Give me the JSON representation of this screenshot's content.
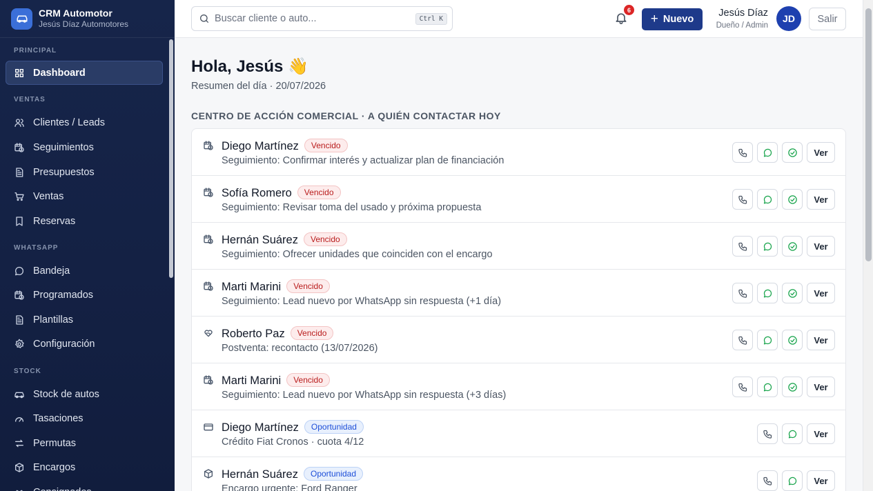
{
  "brand": {
    "title": "CRM Automotor",
    "subtitle": "Jesús Díaz Automotores"
  },
  "sidebar": {
    "sections": [
      {
        "label": "PRINCIPAL",
        "items": [
          {
            "label": "Dashboard",
            "icon": "grid-icon",
            "active": true
          }
        ]
      },
      {
        "label": "VENTAS",
        "items": [
          {
            "label": "Clientes / Leads",
            "icon": "users-icon"
          },
          {
            "label": "Seguimientos",
            "icon": "calendar-clock-icon"
          },
          {
            "label": "Presupuestos",
            "icon": "document-icon"
          },
          {
            "label": "Ventas",
            "icon": "cart-icon"
          },
          {
            "label": "Reservas",
            "icon": "bookmark-icon"
          }
        ]
      },
      {
        "label": "WHATSAPP",
        "items": [
          {
            "label": "Bandeja",
            "icon": "chat-icon"
          },
          {
            "label": "Programados",
            "icon": "calendar-clock-icon"
          },
          {
            "label": "Plantillas",
            "icon": "document-icon"
          },
          {
            "label": "Configuración",
            "icon": "gear-icon"
          }
        ]
      },
      {
        "label": "STOCK",
        "items": [
          {
            "label": "Stock de autos",
            "icon": "car-icon"
          },
          {
            "label": "Tasaciones",
            "icon": "gauge-icon"
          },
          {
            "label": "Permutas",
            "icon": "swap-icon"
          },
          {
            "label": "Encargos",
            "icon": "package-icon"
          },
          {
            "label": "Consignados",
            "icon": "handshake-icon"
          }
        ]
      }
    ]
  },
  "topbar": {
    "search_placeholder": "Buscar cliente o auto...",
    "shortcut": "Ctrl K",
    "notifications_count": "6",
    "new_label": "Nuevo",
    "user_name": "Jesús Díaz",
    "user_role": "Dueño / Admin",
    "avatar_initials": "JD",
    "exit_label": "Salir"
  },
  "main": {
    "greeting": "Hola, Jesús",
    "greeting_emoji": "👋",
    "subtitle": "Resumen del día · 20/07/2026",
    "section_title": "CENTRO DE ACCIÓN COMERCIAL · A QUIÉN CONTACTAR HOY",
    "view_label": "Ver",
    "rows": [
      {
        "name": "Diego Martínez",
        "badge": "Vencido",
        "badge_type": "red",
        "desc": "Seguimiento: Confirmar interés y actualizar plan de financiación",
        "icon": "calendar-clock-icon",
        "done": true
      },
      {
        "name": "Sofía Romero",
        "badge": "Vencido",
        "badge_type": "red",
        "desc": "Seguimiento: Revisar toma del usado y próxima propuesta",
        "icon": "calendar-clock-icon",
        "done": true
      },
      {
        "name": "Hernán Suárez",
        "badge": "Vencido",
        "badge_type": "red",
        "desc": "Seguimiento: Ofrecer unidades que coinciden con el encargo",
        "icon": "calendar-clock-icon",
        "done": true
      },
      {
        "name": "Marti Marini",
        "badge": "Vencido",
        "badge_type": "red",
        "desc": "Seguimiento: Lead nuevo por WhatsApp sin respuesta (+1 día)",
        "icon": "calendar-clock-icon",
        "done": true
      },
      {
        "name": "Roberto Paz",
        "badge": "Vencido",
        "badge_type": "red",
        "desc": "Postventa: recontacto (13/07/2026)",
        "icon": "heart-hand-icon",
        "done": true
      },
      {
        "name": "Marti Marini",
        "badge": "Vencido",
        "badge_type": "red",
        "desc": "Seguimiento: Lead nuevo por WhatsApp sin respuesta (+3 días)",
        "icon": "calendar-clock-icon",
        "done": true
      },
      {
        "name": "Diego Martínez",
        "badge": "Oportunidad",
        "badge_type": "blue",
        "desc": "Crédito Fiat Cronos · cuota 4/12",
        "icon": "credit-card-icon",
        "done": false
      },
      {
        "name": "Hernán Suárez",
        "badge": "Oportunidad",
        "badge_type": "blue",
        "desc": "Encargo urgente: Ford Ranger",
        "icon": "package-icon",
        "done": false
      }
    ]
  },
  "colors": {
    "sidebar_bg": "#16254a",
    "primary": "#1e3a8a",
    "danger": "#dc2626",
    "success": "#16a34a"
  }
}
